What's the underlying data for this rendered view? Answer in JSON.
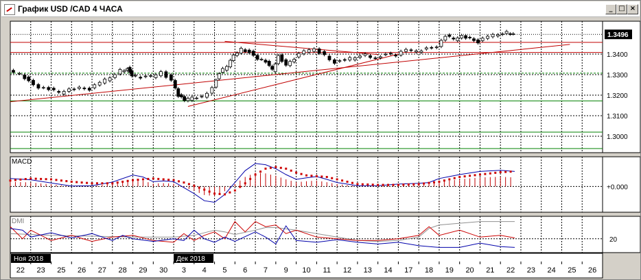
{
  "window": {
    "title": "График USD /CAD  4 ЧАСА",
    "buttons": [
      "_",
      "□",
      "×"
    ]
  },
  "chart_data": {
    "type": "candlestick",
    "symbol": "USD /CAD",
    "timeframe": "4 ЧАСА",
    "price": {
      "ylim": [
        1.292,
        1.356
      ],
      "ticks": [
        "1.3400",
        "1.3300",
        "1.3200",
        "1.3100",
        "1.3000"
      ],
      "current_label": "1.3496",
      "current_value": 1.3496,
      "lower_tick_values": [
        1.34,
        1.33,
        1.32,
        1.31,
        1.3
      ],
      "horizontal_levels": [
        {
          "value": 1.3496,
          "color": "#000000",
          "style": "dotted"
        },
        {
          "value": 1.3457,
          "color": "#c00000",
          "style": "solid"
        },
        {
          "value": 1.3408,
          "color": "#c00000",
          "style": "solid"
        },
        {
          "value": 1.3307,
          "color": "#008000",
          "style": "dashed"
        },
        {
          "value": 1.3172,
          "color": "#008000",
          "style": "solid"
        },
        {
          "value": 1.302,
          "color": "#008000",
          "style": "solid"
        },
        {
          "value": 1.294,
          "color": "#008000",
          "style": "solid"
        }
      ],
      "trendlines": [
        {
          "from": [
            0,
            1.3168
          ],
          "to": [
            27.4,
            1.3447
          ],
          "color": "#c00000"
        },
        {
          "from": [
            8.7,
            1.3145
          ],
          "to": [
            19.0,
            1.34
          ],
          "color": "#c00000"
        },
        {
          "from": [
            10.5,
            1.3462
          ],
          "to": [
            18.0,
            1.3398
          ],
          "color": "#c00000"
        }
      ],
      "close_path": [
        [
          0.0,
          1.332
        ],
        [
          0.6,
          1.33
        ],
        [
          1.0,
          1.327
        ],
        [
          1.5,
          1.324
        ],
        [
          2.0,
          1.323
        ],
        [
          2.5,
          1.321
        ],
        [
          3.0,
          1.3225
        ],
        [
          3.5,
          1.324
        ],
        [
          4.0,
          1.323
        ],
        [
          4.5,
          1.3265
        ],
        [
          5.0,
          1.328
        ],
        [
          5.5,
          1.332
        ],
        [
          5.8,
          1.333
        ],
        [
          6.0,
          1.33
        ],
        [
          6.5,
          1.3285
        ],
        [
          7.0,
          1.329
        ],
        [
          7.5,
          1.331
        ],
        [
          8.0,
          1.3275
        ],
        [
          8.3,
          1.32
        ],
        [
          8.6,
          1.3175
        ],
        [
          9.0,
          1.3185
        ],
        [
          9.5,
          1.319
        ],
        [
          10.0,
          1.324
        ],
        [
          10.3,
          1.331
        ],
        [
          10.7,
          1.334
        ],
        [
          11.0,
          1.339
        ],
        [
          11.4,
          1.3425
        ],
        [
          11.8,
          1.341
        ],
        [
          12.2,
          1.338
        ],
        [
          12.6,
          1.336
        ],
        [
          12.9,
          1.332
        ],
        [
          13.2,
          1.339
        ],
        [
          13.6,
          1.335
        ],
        [
          14.0,
          1.338
        ],
        [
          14.5,
          1.3415
        ],
        [
          15.0,
          1.342
        ],
        [
          15.5,
          1.3395
        ],
        [
          16.0,
          1.336
        ],
        [
          16.5,
          1.3375
        ],
        [
          17.0,
          1.338
        ],
        [
          17.5,
          1.3395
        ],
        [
          18.0,
          1.338
        ],
        [
          18.5,
          1.3405
        ],
        [
          19.0,
          1.3395
        ],
        [
          19.5,
          1.342
        ],
        [
          20.0,
          1.341
        ],
        [
          20.5,
          1.343
        ],
        [
          21.0,
          1.344
        ],
        [
          21.4,
          1.349
        ],
        [
          21.8,
          1.347
        ],
        [
          22.2,
          1.3485
        ],
        [
          22.6,
          1.348
        ],
        [
          23.0,
          1.346
        ],
        [
          23.5,
          1.349
        ],
        [
          24.0,
          1.349
        ],
        [
          24.4,
          1.3505
        ],
        [
          24.7,
          1.35
        ]
      ]
    },
    "macd": {
      "label": "MACD",
      "tick_label": "+0.000",
      "ylim": [
        -0.0065,
        0.0075
      ],
      "line": [
        [
          0,
          0.002
        ],
        [
          1,
          0.0017
        ],
        [
          2,
          0.0009
        ],
        [
          3,
          0.0001
        ],
        [
          4,
          0.0002
        ],
        [
          5,
          0.0011
        ],
        [
          6,
          0.0029
        ],
        [
          6.5,
          0.0024
        ],
        [
          7,
          0.0012
        ],
        [
          7.5,
          0.0014
        ],
        [
          8,
          0.0012
        ],
        [
          8.5,
          -0.0003
        ],
        [
          9,
          -0.0018
        ],
        [
          9.5,
          -0.0036
        ],
        [
          10,
          -0.004
        ],
        [
          10.5,
          -0.002
        ],
        [
          11,
          0.001
        ],
        [
          11.5,
          0.004
        ],
        [
          12,
          0.0058
        ],
        [
          12.5,
          0.0055
        ],
        [
          13,
          0.0045
        ],
        [
          13.5,
          0.003
        ],
        [
          14,
          0.0018
        ],
        [
          14.5,
          0.0022
        ],
        [
          15,
          0.0025
        ],
        [
          15.5,
          0.0018
        ],
        [
          16,
          0.001
        ],
        [
          16.5,
          0.0006
        ],
        [
          17,
          0.0002
        ],
        [
          18,
          0.0002
        ],
        [
          19,
          0.0006
        ],
        [
          20,
          0.0008
        ],
        [
          20.5,
          0.001
        ],
        [
          21,
          0.002
        ],
        [
          21.5,
          0.0025
        ],
        [
          22,
          0.003
        ],
        [
          23,
          0.0038
        ],
        [
          24,
          0.0041
        ],
        [
          24.7,
          0.0038
        ]
      ],
      "signal": [
        [
          0,
          0.0015
        ],
        [
          1,
          0.002
        ],
        [
          2,
          0.0018
        ],
        [
          3,
          0.0012
        ],
        [
          4,
          0.0008
        ],
        [
          5,
          0.0008
        ],
        [
          6,
          0.0016
        ],
        [
          7,
          0.002
        ],
        [
          8,
          0.0016
        ],
        [
          8.5,
          0.001
        ],
        [
          9,
          0.0002
        ],
        [
          9.5,
          -0.0008
        ],
        [
          10,
          -0.0018
        ],
        [
          10.5,
          -0.002
        ],
        [
          11,
          -0.001
        ],
        [
          11.5,
          0.0008
        ],
        [
          12,
          0.003
        ],
        [
          12.5,
          0.0045
        ],
        [
          13,
          0.0049
        ],
        [
          13.5,
          0.0045
        ],
        [
          14,
          0.0035
        ],
        [
          14.5,
          0.0028
        ],
        [
          15,
          0.0026
        ],
        [
          15.5,
          0.0024
        ],
        [
          16,
          0.0018
        ],
        [
          16.5,
          0.0012
        ],
        [
          17,
          0.0006
        ],
        [
          18,
          0.0004
        ],
        [
          19,
          0.0004
        ],
        [
          20,
          0.0006
        ],
        [
          21,
          0.0012
        ],
        [
          21.5,
          0.0018
        ],
        [
          22,
          0.0024
        ],
        [
          23,
          0.003
        ],
        [
          24,
          0.0036
        ],
        [
          24.7,
          0.0038
        ]
      ]
    },
    "dmi": {
      "label": "DMI",
      "tick_label": "20",
      "tick_value": 20,
      "ylim": [
        4,
        46
      ],
      "plus_di": [
        [
          0,
          32
        ],
        [
          0.6,
          30
        ],
        [
          1,
          22
        ],
        [
          2,
          27
        ],
        [
          3,
          21
        ],
        [
          4,
          26
        ],
        [
          5,
          18
        ],
        [
          5.5,
          24
        ],
        [
          6,
          20
        ],
        [
          7,
          17
        ],
        [
          8,
          20
        ],
        [
          8.5,
          18
        ],
        [
          9,
          30
        ],
        [
          9.5,
          20
        ],
        [
          10,
          16
        ],
        [
          10.5,
          22
        ],
        [
          11,
          17
        ],
        [
          12,
          28
        ],
        [
          12.5,
          22
        ],
        [
          13,
          14
        ],
        [
          13.5,
          35
        ],
        [
          14,
          18
        ],
        [
          15,
          16
        ],
        [
          16,
          19
        ],
        [
          17,
          16
        ],
        [
          18,
          14
        ],
        [
          19,
          16
        ],
        [
          20,
          12
        ],
        [
          21,
          10
        ],
        [
          22,
          10
        ],
        [
          23,
          15
        ],
        [
          24,
          11
        ],
        [
          24.7,
          10
        ]
      ],
      "minus_di": [
        [
          0,
          34
        ],
        [
          0.6,
          20
        ],
        [
          1,
          30
        ],
        [
          2,
          18
        ],
        [
          3,
          24
        ],
        [
          4,
          17
        ],
        [
          5,
          22
        ],
        [
          6,
          24
        ],
        [
          7,
          18
        ],
        [
          8,
          16
        ],
        [
          8.5,
          26
        ],
        [
          9,
          18
        ],
        [
          9.5,
          24
        ],
        [
          10,
          28
        ],
        [
          10.5,
          20
        ],
        [
          11,
          40
        ],
        [
          11.5,
          28
        ],
        [
          12,
          40
        ],
        [
          12.5,
          34
        ],
        [
          13,
          36
        ],
        [
          13.5,
          26
        ],
        [
          14,
          30
        ],
        [
          15,
          22
        ],
        [
          16,
          20
        ],
        [
          17,
          18
        ],
        [
          18,
          18
        ],
        [
          19,
          20
        ],
        [
          20,
          24
        ],
        [
          20.5,
          34
        ],
        [
          21,
          24
        ],
        [
          22,
          30
        ],
        [
          23,
          22
        ],
        [
          24,
          24
        ],
        [
          24.7,
          21
        ]
      ],
      "adx": [
        [
          0,
          26
        ],
        [
          2,
          24
        ],
        [
          4,
          23
        ],
        [
          6,
          22
        ],
        [
          8,
          22
        ],
        [
          9,
          24
        ],
        [
          10,
          30
        ],
        [
          10.5,
          28
        ],
        [
          11,
          25
        ],
        [
          12,
          30
        ],
        [
          12.5,
          33
        ],
        [
          13,
          33
        ],
        [
          14,
          30
        ],
        [
          15,
          26
        ],
        [
          16,
          22
        ],
        [
          17,
          18
        ],
        [
          18,
          17
        ],
        [
          19,
          18
        ],
        [
          20,
          22
        ],
        [
          20.5,
          32
        ],
        [
          21,
          36
        ],
        [
          22,
          38
        ],
        [
          23,
          40
        ],
        [
          24,
          40
        ],
        [
          24.7,
          40
        ]
      ]
    },
    "x_axis": {
      "ticks": [
        "22",
        "23",
        "25",
        "26",
        "27",
        "28",
        "29",
        "30",
        "3",
        "4",
        "5",
        "6",
        "7",
        "9",
        "10",
        "11",
        "12",
        "13",
        "14",
        "17",
        "18",
        "19",
        "20",
        "21",
        "22",
        "23",
        "24",
        "25",
        "26"
      ],
      "month_labels": [
        {
          "text": "Ноя 2018",
          "index": 0
        },
        {
          "text": "Дек 2018",
          "index": 8
        }
      ]
    }
  }
}
